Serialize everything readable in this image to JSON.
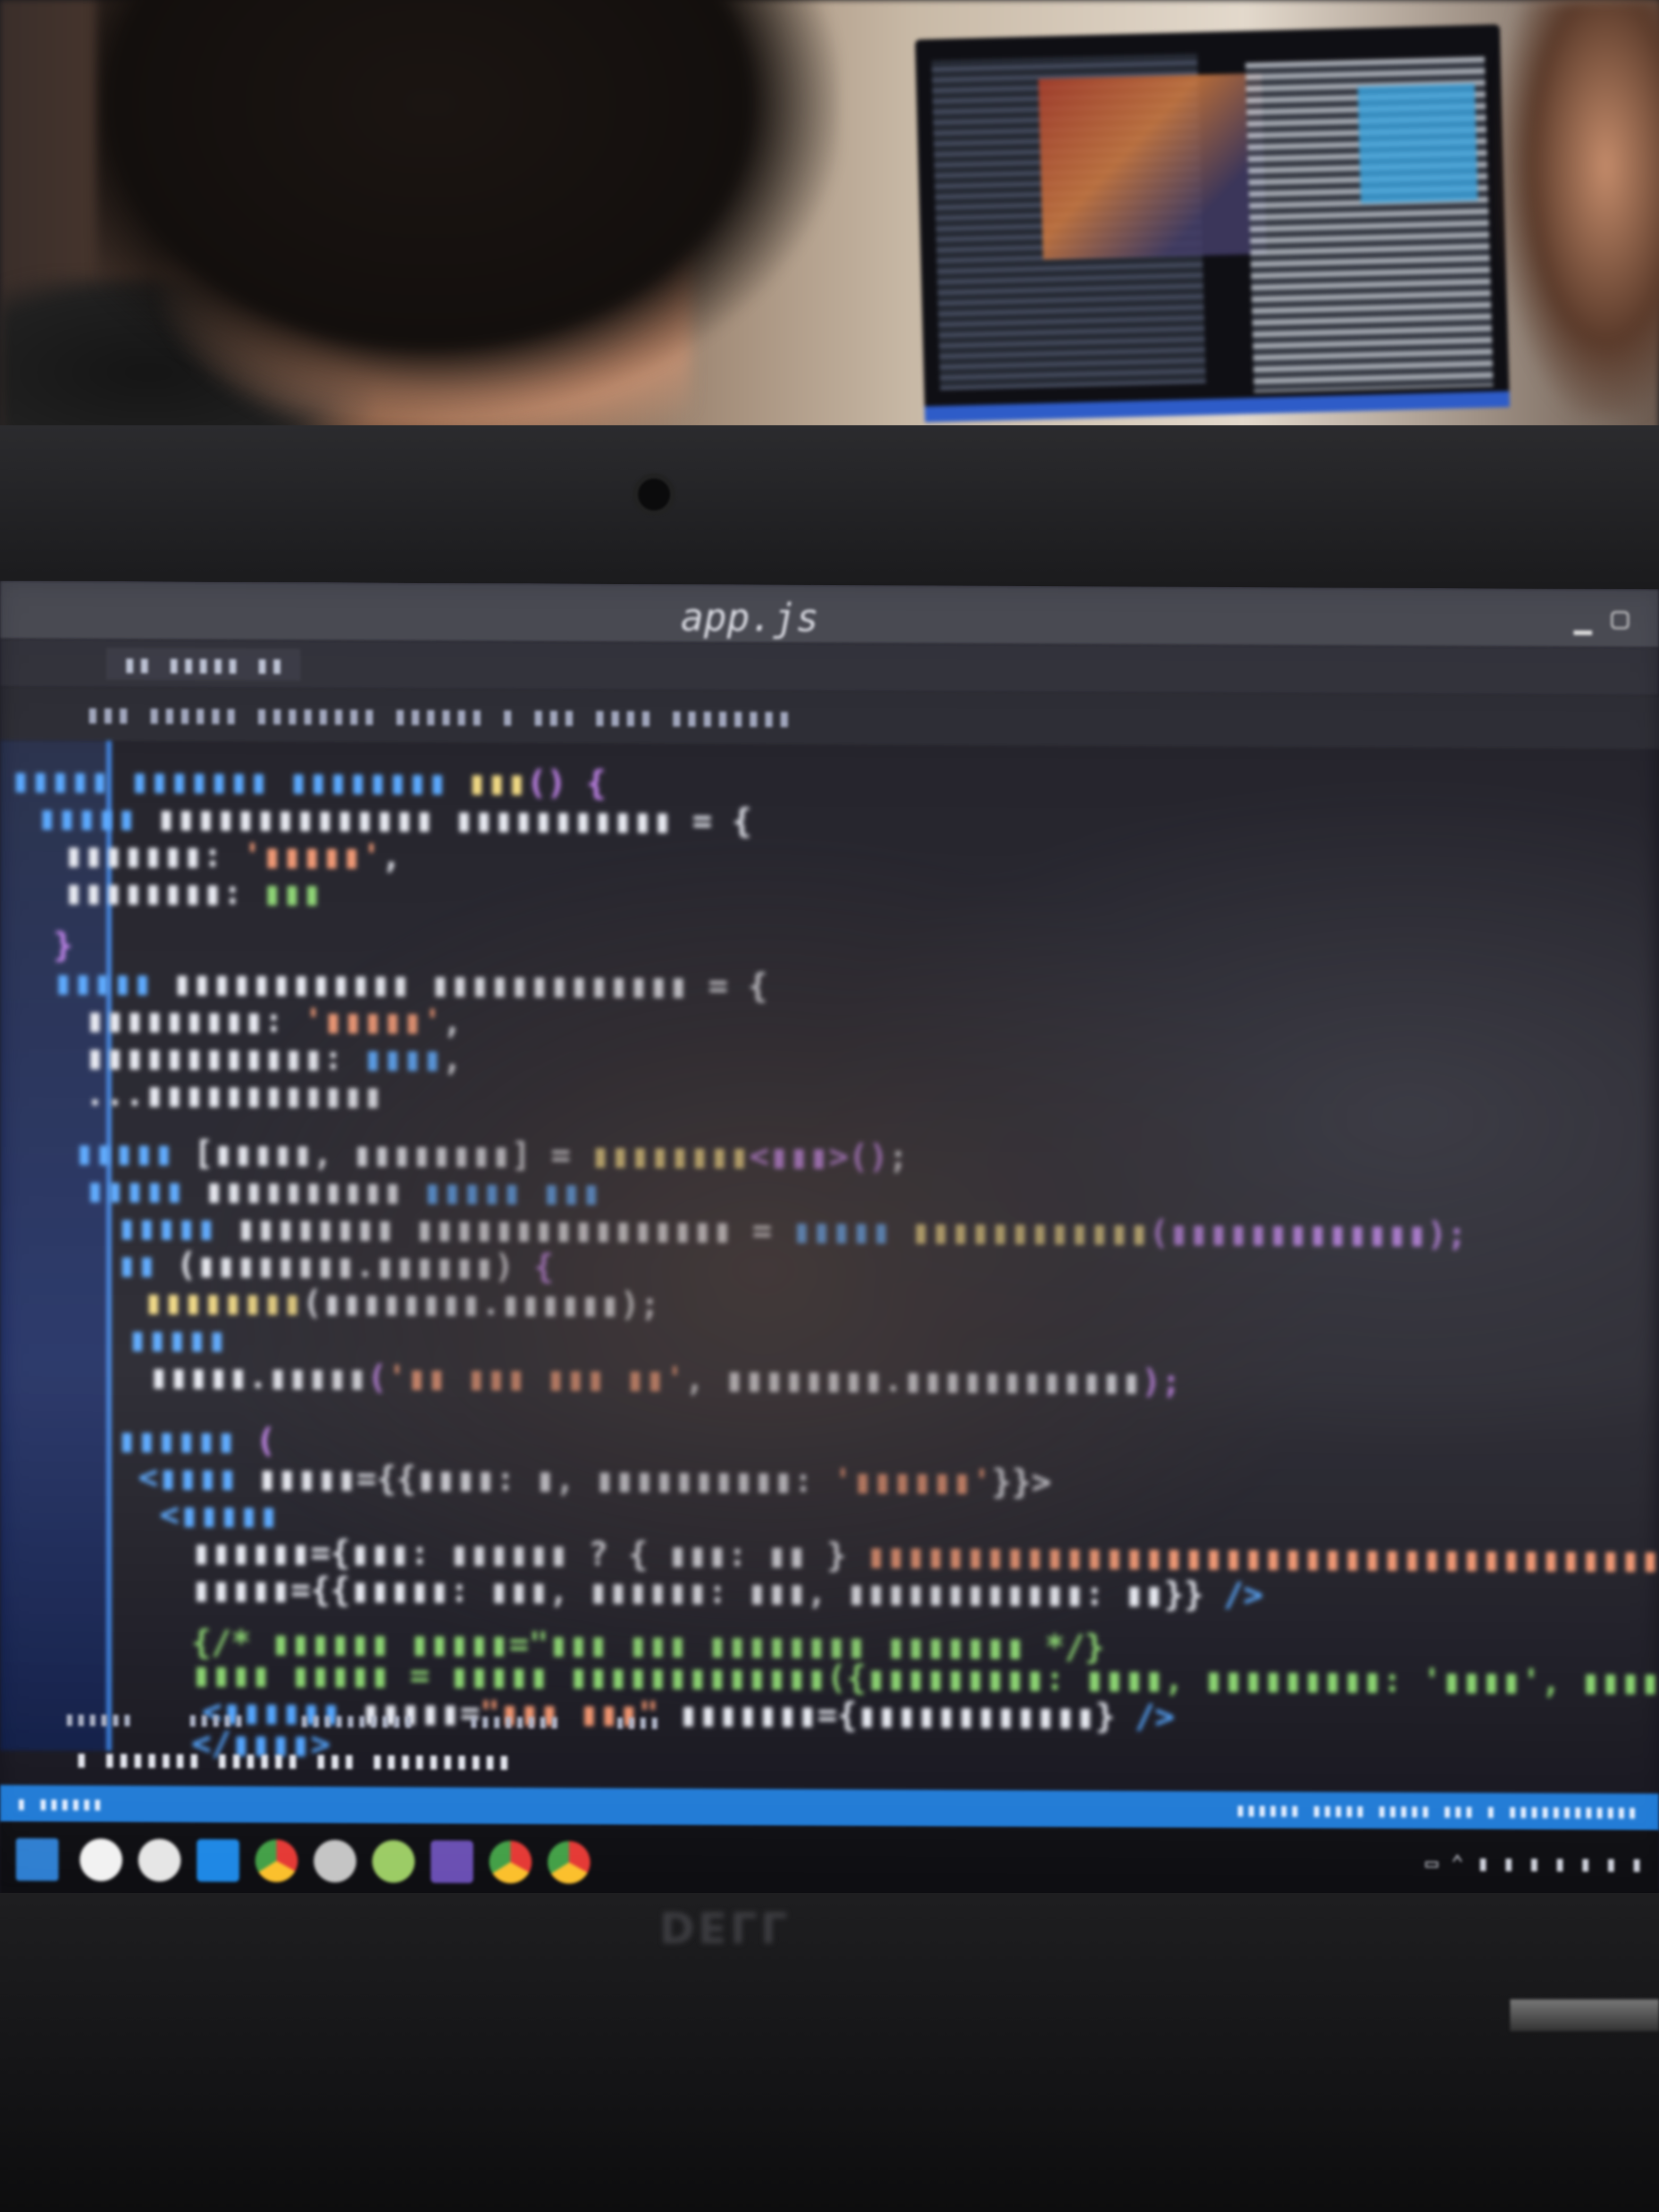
{
  "scene": {
    "kind": "photo",
    "subject": "laptop screen with code editor, people reflected",
    "device_brand": "DELL"
  },
  "editor": {
    "title": "app.js",
    "theme_colors": {
      "keyword": "#4fa3ff",
      "function": "#f1d77a",
      "string": "#f0916a",
      "comment": "#86d36b",
      "status_bar": "#1f7ad6"
    }
  },
  "taskbar": {
    "icons": [
      "windows-icon",
      "search-icon",
      "task-view-icon",
      "file-explorer-icon",
      "vscode-icon",
      "chrome-icon",
      "chrome-icon",
      "chrome-icon"
    ]
  }
}
